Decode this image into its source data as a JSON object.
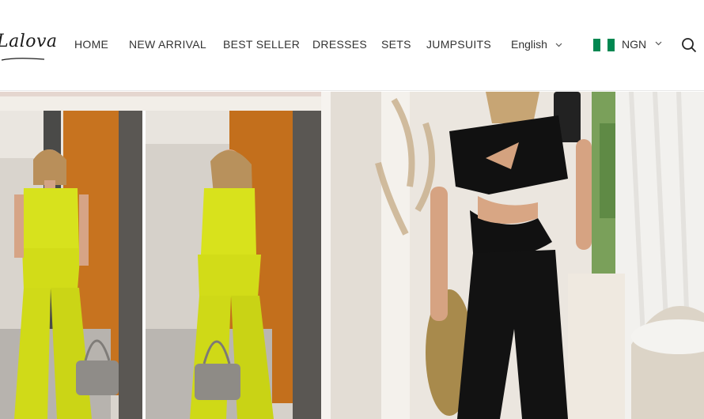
{
  "brand": {
    "logo_text": "Lalova"
  },
  "nav": {
    "items": [
      {
        "label": "HOME"
      },
      {
        "label": "NEW ARRIVAL"
      },
      {
        "label": "BEST SELLER"
      },
      {
        "label": "DRESSES"
      },
      {
        "label": "SETS"
      },
      {
        "label": "JUMPSUITS"
      }
    ]
  },
  "language": {
    "label": "English",
    "icon": "chevron-down-icon"
  },
  "currency": {
    "label": "NGN",
    "flag": "nigeria-flag-icon",
    "icon": "chevron-down-icon"
  },
  "search": {
    "icon": "search-icon"
  },
  "colors": {
    "text": "#333333",
    "flag_green": "#008751",
    "flag_white": "#ffffff",
    "jumpsuit_yellow": "#d8e21a",
    "jumpsuit_black": "#111111"
  },
  "hero": {
    "left_image": "two-piece-yellow-set-photo",
    "right_image": "black-cutout-jumpsuit-photo"
  }
}
